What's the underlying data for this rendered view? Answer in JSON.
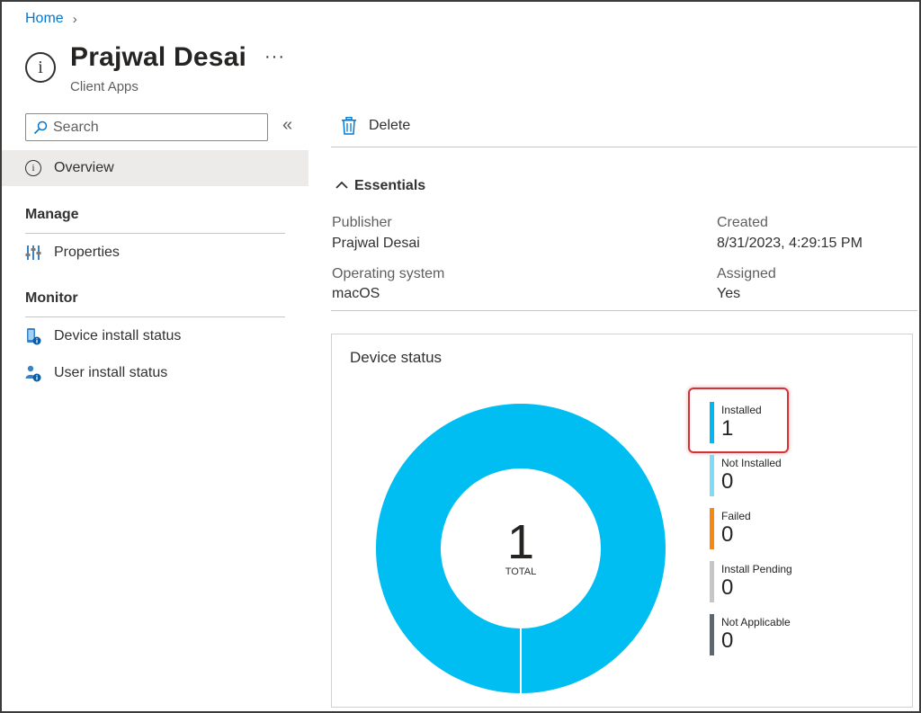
{
  "breadcrumb": {
    "home": "Home",
    "separator": "›"
  },
  "header": {
    "title": "Prajwal Desai",
    "subtitle": "Client Apps",
    "more": "···"
  },
  "sidebar": {
    "search_placeholder": "Search",
    "collapse": "«",
    "overview": "Overview",
    "manage_heading": "Manage",
    "properties": "Properties",
    "monitor_heading": "Monitor",
    "device_install_status": "Device install status",
    "user_install_status": "User install status"
  },
  "toolbar": {
    "delete_label": "Delete"
  },
  "essentials": {
    "heading": "Essentials",
    "publisher_label": "Publisher",
    "publisher_value": "Prajwal Desai",
    "os_label": "Operating system",
    "os_value": "macOS",
    "created_label": "Created",
    "created_value": "8/31/2023, 4:29:15 PM",
    "assigned_label": "Assigned",
    "assigned_value": "Yes"
  },
  "device_status": {
    "title": "Device status",
    "total_value": "1",
    "total_label": "TOTAL",
    "legend": [
      {
        "label": "Installed",
        "count": "1",
        "color": "#00b7f1"
      },
      {
        "label": "Not Installed",
        "count": "0",
        "color": "#7fdbf6"
      },
      {
        "label": "Failed",
        "count": "0",
        "color": "#f7870f"
      },
      {
        "label": "Install Pending",
        "count": "0",
        "color": "#c8c6c4"
      },
      {
        "label": "Not Applicable",
        "count": "0",
        "color": "#5c6770"
      }
    ],
    "ring_color": "#00bdf2"
  },
  "icons": {
    "title": "info-icon",
    "search": "search-icon",
    "delete": "trash-icon",
    "properties": "properties-icon",
    "device": "device-icon",
    "user": "user-icon"
  }
}
